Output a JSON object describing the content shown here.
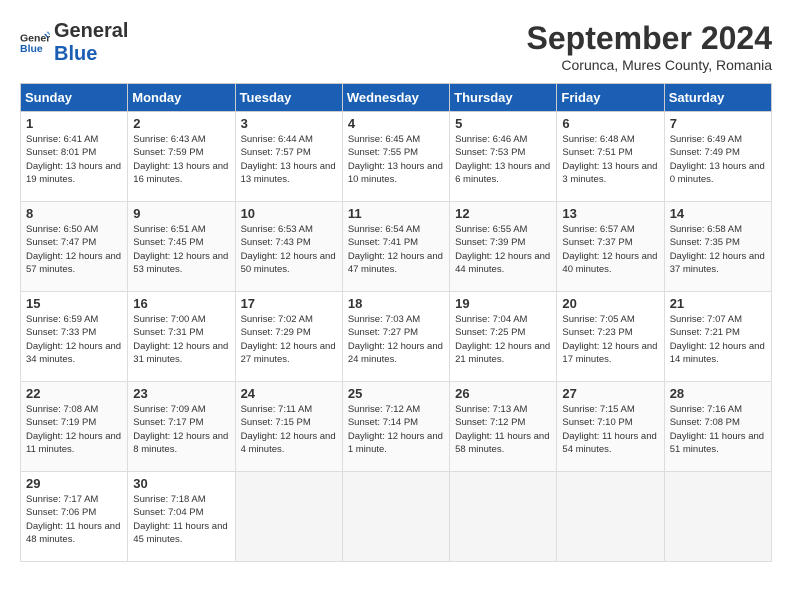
{
  "header": {
    "logo_general": "General",
    "logo_blue": "Blue",
    "month": "September 2024",
    "location": "Corunca, Mures County, Romania"
  },
  "weekdays": [
    "Sunday",
    "Monday",
    "Tuesday",
    "Wednesday",
    "Thursday",
    "Friday",
    "Saturday"
  ],
  "weeks": [
    [
      {
        "day": 1,
        "sunrise": "6:41 AM",
        "sunset": "8:01 PM",
        "daylight": "13 hours and 19 minutes."
      },
      {
        "day": 2,
        "sunrise": "6:43 AM",
        "sunset": "7:59 PM",
        "daylight": "13 hours and 16 minutes."
      },
      {
        "day": 3,
        "sunrise": "6:44 AM",
        "sunset": "7:57 PM",
        "daylight": "13 hours and 13 minutes."
      },
      {
        "day": 4,
        "sunrise": "6:45 AM",
        "sunset": "7:55 PM",
        "daylight": "13 hours and 10 minutes."
      },
      {
        "day": 5,
        "sunrise": "6:46 AM",
        "sunset": "7:53 PM",
        "daylight": "13 hours and 6 minutes."
      },
      {
        "day": 6,
        "sunrise": "6:48 AM",
        "sunset": "7:51 PM",
        "daylight": "13 hours and 3 minutes."
      },
      {
        "day": 7,
        "sunrise": "6:49 AM",
        "sunset": "7:49 PM",
        "daylight": "13 hours and 0 minutes."
      }
    ],
    [
      {
        "day": 8,
        "sunrise": "6:50 AM",
        "sunset": "7:47 PM",
        "daylight": "12 hours and 57 minutes."
      },
      {
        "day": 9,
        "sunrise": "6:51 AM",
        "sunset": "7:45 PM",
        "daylight": "12 hours and 53 minutes."
      },
      {
        "day": 10,
        "sunrise": "6:53 AM",
        "sunset": "7:43 PM",
        "daylight": "12 hours and 50 minutes."
      },
      {
        "day": 11,
        "sunrise": "6:54 AM",
        "sunset": "7:41 PM",
        "daylight": "12 hours and 47 minutes."
      },
      {
        "day": 12,
        "sunrise": "6:55 AM",
        "sunset": "7:39 PM",
        "daylight": "12 hours and 44 minutes."
      },
      {
        "day": 13,
        "sunrise": "6:57 AM",
        "sunset": "7:37 PM",
        "daylight": "12 hours and 40 minutes."
      },
      {
        "day": 14,
        "sunrise": "6:58 AM",
        "sunset": "7:35 PM",
        "daylight": "12 hours and 37 minutes."
      }
    ],
    [
      {
        "day": 15,
        "sunrise": "6:59 AM",
        "sunset": "7:33 PM",
        "daylight": "12 hours and 34 minutes."
      },
      {
        "day": 16,
        "sunrise": "7:00 AM",
        "sunset": "7:31 PM",
        "daylight": "12 hours and 31 minutes."
      },
      {
        "day": 17,
        "sunrise": "7:02 AM",
        "sunset": "7:29 PM",
        "daylight": "12 hours and 27 minutes."
      },
      {
        "day": 18,
        "sunrise": "7:03 AM",
        "sunset": "7:27 PM",
        "daylight": "12 hours and 24 minutes."
      },
      {
        "day": 19,
        "sunrise": "7:04 AM",
        "sunset": "7:25 PM",
        "daylight": "12 hours and 21 minutes."
      },
      {
        "day": 20,
        "sunrise": "7:05 AM",
        "sunset": "7:23 PM",
        "daylight": "12 hours and 17 minutes."
      },
      {
        "day": 21,
        "sunrise": "7:07 AM",
        "sunset": "7:21 PM",
        "daylight": "12 hours and 14 minutes."
      }
    ],
    [
      {
        "day": 22,
        "sunrise": "7:08 AM",
        "sunset": "7:19 PM",
        "daylight": "12 hours and 11 minutes."
      },
      {
        "day": 23,
        "sunrise": "7:09 AM",
        "sunset": "7:17 PM",
        "daylight": "12 hours and 8 minutes."
      },
      {
        "day": 24,
        "sunrise": "7:11 AM",
        "sunset": "7:15 PM",
        "daylight": "12 hours and 4 minutes."
      },
      {
        "day": 25,
        "sunrise": "7:12 AM",
        "sunset": "7:14 PM",
        "daylight": "12 hours and 1 minute."
      },
      {
        "day": 26,
        "sunrise": "7:13 AM",
        "sunset": "7:12 PM",
        "daylight": "11 hours and 58 minutes."
      },
      {
        "day": 27,
        "sunrise": "7:15 AM",
        "sunset": "7:10 PM",
        "daylight": "11 hours and 54 minutes."
      },
      {
        "day": 28,
        "sunrise": "7:16 AM",
        "sunset": "7:08 PM",
        "daylight": "11 hours and 51 minutes."
      }
    ],
    [
      {
        "day": 29,
        "sunrise": "7:17 AM",
        "sunset": "7:06 PM",
        "daylight": "11 hours and 48 minutes."
      },
      {
        "day": 30,
        "sunrise": "7:18 AM",
        "sunset": "7:04 PM",
        "daylight": "11 hours and 45 minutes."
      },
      null,
      null,
      null,
      null,
      null
    ]
  ]
}
